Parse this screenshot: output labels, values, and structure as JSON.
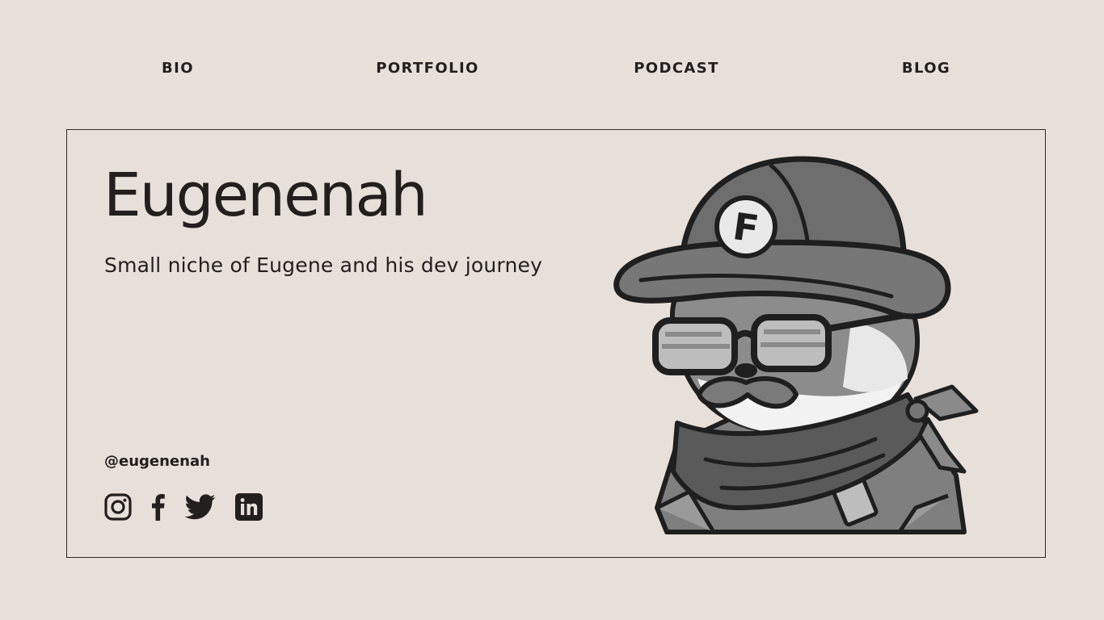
{
  "nav": {
    "bio": "BIO",
    "portfolio": "PORTFOLIO",
    "podcast": "PODCAST",
    "blog": "BLOG"
  },
  "hero": {
    "title": "Eugenenah",
    "tagline": "Small niche of Eugene and his dev journey",
    "handle": "@eugenenah",
    "mascot_badge_letter": "F"
  },
  "socials": [
    {
      "icon": "instagram-icon"
    },
    {
      "icon": "facebook-icon"
    },
    {
      "icon": "twitter-icon"
    },
    {
      "icon": "linkedin-icon"
    }
  ],
  "colors": {
    "background": "#e7dfd9",
    "text": "#231f1e",
    "border": "#2f2a28"
  }
}
